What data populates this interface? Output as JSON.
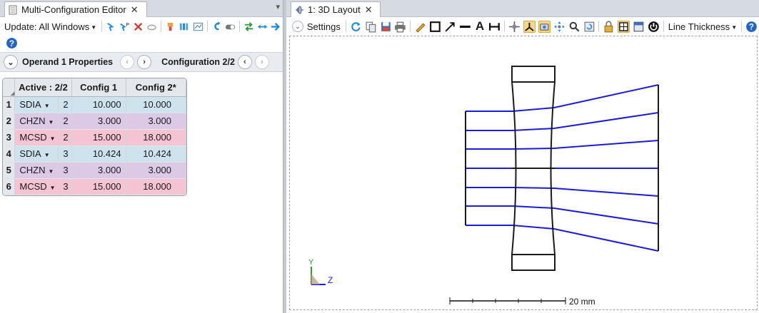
{
  "left_tab": {
    "title": "Multi-Configuration Editor",
    "close": "✕"
  },
  "pane_menu": "▾",
  "toolbar": {
    "update_label": "Update: All Windows",
    "help": "?"
  },
  "operand_bar": {
    "operand_label": "Operand  1 Properties",
    "config_label": "Configuration 2/2"
  },
  "table": {
    "corner": "◢",
    "headers": [
      "Active : 2/2",
      "Config 1",
      "Config 2*"
    ],
    "rows": [
      {
        "num": "1",
        "op": "SDIA",
        "surf": "2",
        "c1": "10.000",
        "c2": "10.000"
      },
      {
        "num": "2",
        "op": "CHZN",
        "surf": "2",
        "c1": "3.000",
        "c2": "3.000"
      },
      {
        "num": "3",
        "op": "MCSD",
        "surf": "2",
        "c1": "15.000",
        "c2": "18.000"
      },
      {
        "num": "4",
        "op": "SDIA",
        "surf": "3",
        "c1": "10.424",
        "c2": "10.424"
      },
      {
        "num": "5",
        "op": "CHZN",
        "surf": "3",
        "c1": "3.000",
        "c2": "3.000"
      },
      {
        "num": "6",
        "op": "MCSD",
        "surf": "3",
        "c1": "15.000",
        "c2": "18.000"
      }
    ]
  },
  "right_tab": {
    "title": "1: 3D Layout",
    "close": "✕"
  },
  "right_toolbar": {
    "settings": "Settings",
    "line_thickness": "Line Thickness",
    "text_tool": "A"
  },
  "layout": {
    "axis_y": "Y",
    "axis_z": "Z",
    "scale_label": "20 mm",
    "ray_color": "#1a1adb",
    "lens_color": "#1a1a1a"
  },
  "colors": {
    "row_blue": "#cfe3ee",
    "row_purple": "#dcc9e6",
    "row_pink": "#f5c4d2"
  }
}
